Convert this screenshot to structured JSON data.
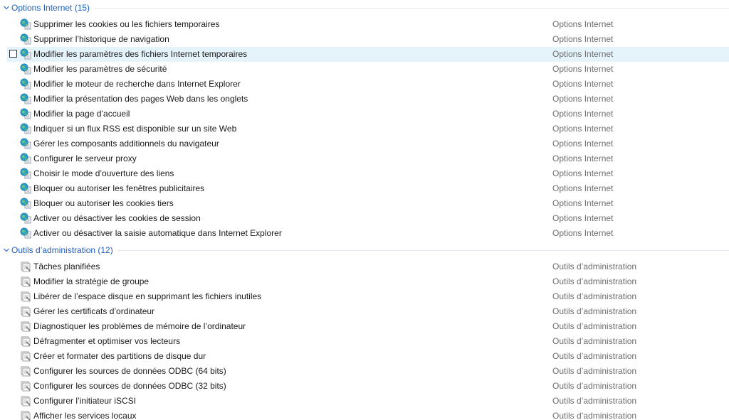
{
  "groups": [
    {
      "title": "Options Internet (15)",
      "icon": "internet-options-icon",
      "items": [
        {
          "name": "Supprimer les cookies ou les fichiers temporaires",
          "category": "Options Internet"
        },
        {
          "name": "Supprimer l’historique de navigation",
          "category": "Options Internet"
        },
        {
          "name": "Modifier les paramètres des fichiers Internet temporaires",
          "category": "Options Internet",
          "selected": true
        },
        {
          "name": "Modifier les paramètres de sécurité",
          "category": "Options Internet"
        },
        {
          "name": "Modifier le moteur de recherche dans Internet Explorer",
          "category": "Options Internet"
        },
        {
          "name": "Modifier la présentation des pages Web dans les onglets",
          "category": "Options Internet"
        },
        {
          "name": "Modifier la page d’accueil",
          "category": "Options Internet"
        },
        {
          "name": "Indiquer si un flux RSS est disponible sur un site Web",
          "category": "Options Internet"
        },
        {
          "name": "Gérer les composants additionnels du navigateur",
          "category": "Options Internet"
        },
        {
          "name": "Configurer le serveur proxy",
          "category": "Options Internet"
        },
        {
          "name": "Choisir le mode d’ouverture des liens",
          "category": "Options Internet"
        },
        {
          "name": "Bloquer ou autoriser les fenêtres publicitaires",
          "category": "Options Internet"
        },
        {
          "name": "Bloquer ou autoriser les cookies tiers",
          "category": "Options Internet"
        },
        {
          "name": "Activer ou désactiver les cookies de session",
          "category": "Options Internet"
        },
        {
          "name": "Activer ou désactiver la saisie automatique dans Internet Explorer",
          "category": "Options Internet"
        }
      ]
    },
    {
      "title": "Outils d’administration (12)",
      "icon": "admin-tools-icon",
      "items": [
        {
          "name": "Tâches planifiées",
          "category": "Outils d’administration"
        },
        {
          "name": "Modifier la stratégie de groupe",
          "category": "Outils d’administration"
        },
        {
          "name": "Libérer de l’espace disque en supprimant les fichiers inutiles",
          "category": "Outils d’administration"
        },
        {
          "name": "Gérer les certificats d’ordinateur",
          "category": "Outils d’administration"
        },
        {
          "name": "Diagnostiquer les problèmes de mémoire de l’ordinateur",
          "category": "Outils d’administration"
        },
        {
          "name": "Défragmenter et optimiser vos lecteurs",
          "category": "Outils d’administration"
        },
        {
          "name": "Créer et formater des partitions de disque dur",
          "category": "Outils d’administration"
        },
        {
          "name": "Configurer les sources de données ODBC (64 bits)",
          "category": "Outils d’administration"
        },
        {
          "name": "Configurer les sources de données ODBC (32 bits)",
          "category": "Outils d’administration"
        },
        {
          "name": "Configurer l’initiateur iSCSI",
          "category": "Outils d’administration"
        },
        {
          "name": "Afficher les services locaux",
          "category": "Outils d’administration"
        }
      ]
    }
  ],
  "colors": {
    "group_title": "#1f5fbf",
    "selection": "#e5f3fb",
    "category_text": "#6d6d6d",
    "item_text": "#1a1a1a"
  }
}
